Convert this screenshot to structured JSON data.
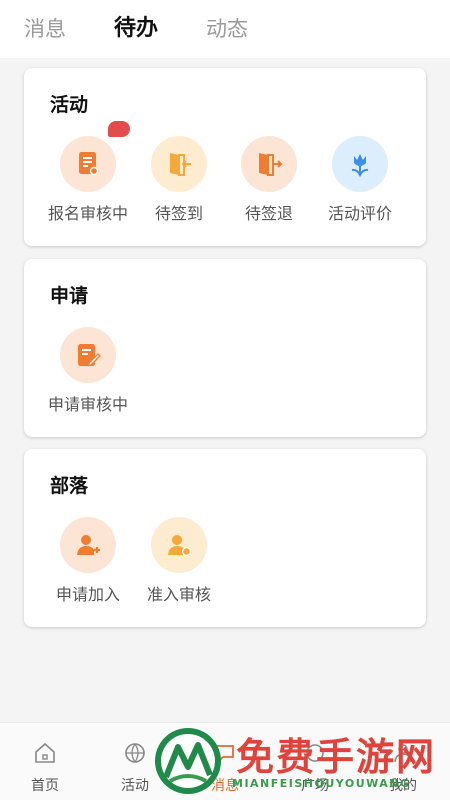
{
  "tabs": [
    {
      "label": "消息",
      "active": false
    },
    {
      "label": "待办",
      "active": true
    },
    {
      "label": "动态",
      "active": false
    }
  ],
  "sections": [
    {
      "title": "活动",
      "items": [
        {
          "label": "报名审核中",
          "icon": "document-review-icon",
          "badge": true
        },
        {
          "label": "待签到",
          "icon": "door-enter-icon"
        },
        {
          "label": "待签退",
          "icon": "door-exit-icon"
        },
        {
          "label": "活动评价",
          "icon": "tulip-icon"
        }
      ]
    },
    {
      "title": "申请",
      "items": [
        {
          "label": "申请审核中",
          "icon": "edit-document-icon"
        }
      ]
    },
    {
      "title": "部落",
      "items": [
        {
          "label": "申请加入",
          "icon": "add-user-icon"
        },
        {
          "label": "准入审核",
          "icon": "user-check-icon"
        }
      ]
    }
  ],
  "bottom_nav": [
    {
      "label": "首页",
      "icon": "home-icon"
    },
    {
      "label": "活动",
      "icon": "basketball-icon"
    },
    {
      "label": "消息",
      "icon": "chat-icon",
      "active": true
    },
    {
      "label": "广场",
      "icon": "square-icon"
    },
    {
      "label": "我的",
      "icon": "profile-icon"
    }
  ],
  "watermark": {
    "text": "免费手游网",
    "sub": "MIANFEISHOUYOUWANG"
  },
  "colors": {
    "orange": "#f07c32",
    "orange_light": "#fde5d6",
    "yellow": "#f4a93a",
    "yellow_light": "#fdeccf",
    "blue": "#3b8fe4",
    "blue_light": "#dceefc",
    "badge": "#e34c4c",
    "watermark_red": "#e0433c",
    "watermark_green": "#3a9b4d"
  }
}
